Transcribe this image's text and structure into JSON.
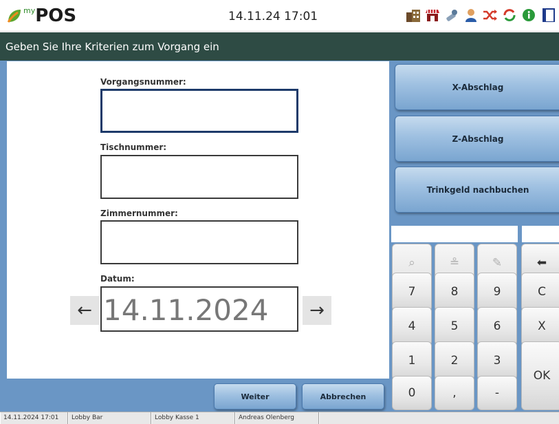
{
  "header": {
    "logo_my": "my",
    "logo_pos": "POS",
    "datetime": "14.11.24  17:01",
    "icons": [
      "hotel-icon",
      "store-icon",
      "tools-icon",
      "user-icon",
      "shuffle-icon",
      "refresh-icon",
      "info-icon",
      "window-icon"
    ]
  },
  "title": "Geben Sie Ihre Kriterien zum Vorgang ein",
  "form": {
    "vorgang_label": "Vorgangsnummer:",
    "vorgang_value": "",
    "tisch_label": "Tischnummer:",
    "tisch_value": "",
    "zimmer_label": "Zimmernummer:",
    "zimmer_value": "",
    "datum_label": "Datum:",
    "datum_value": "14.11.2024",
    "prev_arrow": "←",
    "next_arrow": "→"
  },
  "actions": {
    "x_abschlag": "X-Abschlag",
    "z_abschlag": "Z-Abschlag",
    "trinkgeld": "Trinkgeld nachbuchen"
  },
  "keypad": {
    "search_icon": "⌕",
    "stamp_icon": "≗",
    "edit_icon": "✎",
    "backspace": "⬅",
    "k7": "7",
    "k8": "8",
    "k9": "9",
    "clear": "C",
    "k4": "4",
    "k5": "5",
    "k6": "6",
    "cancel": "X",
    "k1": "1",
    "k2": "2",
    "k3": "3",
    "ok": "OK",
    "k0": "0",
    "comma": ",",
    "minus": "-"
  },
  "buttons": {
    "weiter": "Weiter",
    "abbrechen": "Abbrechen"
  },
  "status": {
    "datetime": "14.11.2024 17:01",
    "location": "Lobby Bar",
    "register": "Lobby Kasse 1",
    "user": "Andreas Olenberg"
  },
  "colors": {
    "titlebar": "#2e4b44",
    "panel_background": "#6a96c5",
    "button_blue": "#9ec0e1"
  }
}
